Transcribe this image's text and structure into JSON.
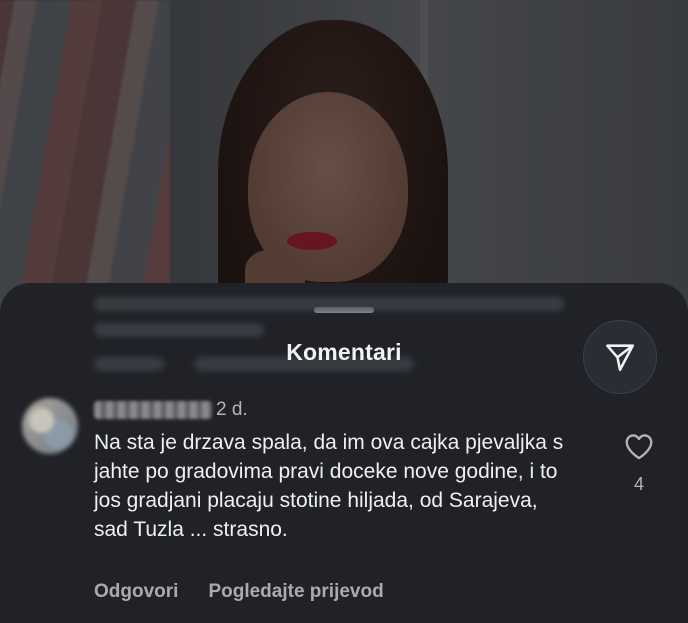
{
  "sheet": {
    "title": "Komentari"
  },
  "icons": {
    "share": "send-paper-plane-icon",
    "like": "heart-icon"
  },
  "comment": {
    "timestamp": "2 d.",
    "text": "Na sta je drzava spala, da im ova cajka pjevaljka s jahte po gradovima pravi doceke nove godine, i to jos gradjani placaju stotine hiljada, od Sarajeva, sad Tuzla ... strasno.",
    "likes": "4",
    "reply_label": "Odgovori",
    "translate_label": "Pogledajte prijevod"
  },
  "colors": {
    "sheet_background": "#202228",
    "primary_text": "#eef0f2",
    "secondary_text": "#a9abb0"
  }
}
